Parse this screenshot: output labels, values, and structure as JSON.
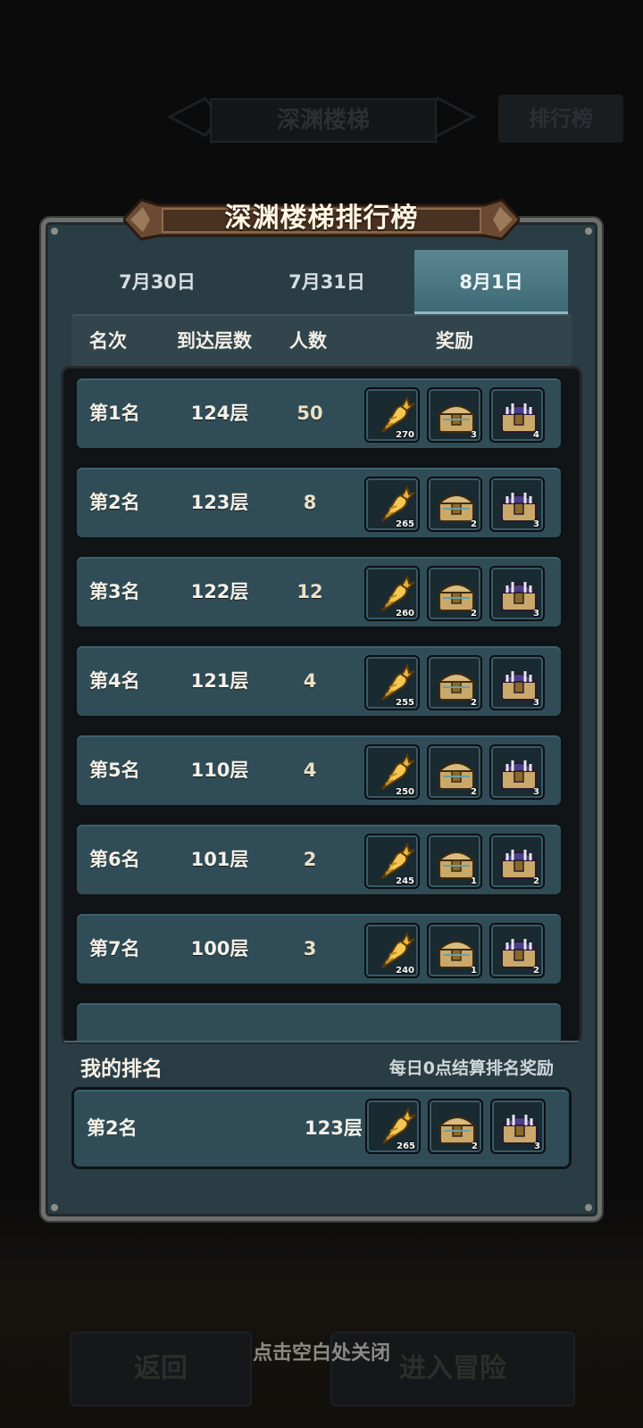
{
  "background": {
    "header_title": "深渊楼梯",
    "rank_button": "排行榜",
    "back_button": "返回",
    "enter_button": "进入冒险",
    "close_hint": "点击空白处关闭"
  },
  "dialog": {
    "title": "深渊楼梯排行榜",
    "tabs": [
      {
        "label": "7月30日",
        "active": false
      },
      {
        "label": "7月31日",
        "active": false
      },
      {
        "label": "8月1日",
        "active": true
      }
    ],
    "columns": {
      "rank": "名次",
      "floor": "到达层数",
      "count": "人数",
      "reward": "奖励"
    },
    "rows": [
      {
        "rank": "第1名",
        "floor": "124层",
        "count": "50",
        "rewards": [
          "270",
          "3",
          "4"
        ]
      },
      {
        "rank": "第2名",
        "floor": "123层",
        "count": "8",
        "rewards": [
          "265",
          "2",
          "3"
        ]
      },
      {
        "rank": "第3名",
        "floor": "122层",
        "count": "12",
        "rewards": [
          "260",
          "2",
          "3"
        ]
      },
      {
        "rank": "第4名",
        "floor": "121层",
        "count": "4",
        "rewards": [
          "255",
          "2",
          "3"
        ]
      },
      {
        "rank": "第5名",
        "floor": "110层",
        "count": "4",
        "rewards": [
          "250",
          "2",
          "3"
        ]
      },
      {
        "rank": "第6名",
        "floor": "101层",
        "count": "2",
        "rewards": [
          "245",
          "1",
          "2"
        ]
      },
      {
        "rank": "第7名",
        "floor": "100层",
        "count": "3",
        "rewards": [
          "240",
          "1",
          "2"
        ]
      }
    ],
    "reward_icons": [
      "golden-carrot-icon",
      "gold-chest-icon",
      "purple-chest-icon"
    ],
    "my_rank": {
      "title": "我的排名",
      "note": "每日0点结算排名奖励",
      "rank": "第2名",
      "floor": "123层",
      "rewards": [
        "265",
        "2",
        "3"
      ]
    }
  },
  "colors": {
    "panel": "#2a3d45",
    "row": "#2f4c57",
    "active_tab": "#4e7985",
    "banner": "#5a3c2a"
  }
}
